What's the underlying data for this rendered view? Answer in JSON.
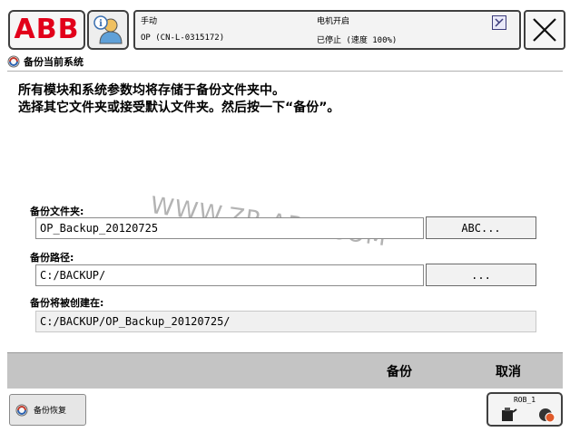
{
  "status": {
    "logo_text": "ABB",
    "mode": "手动",
    "controller": "OP (CN-L-0315172)",
    "motor": "电机开启",
    "state": "已停止 (速度 100%)"
  },
  "window": {
    "title": "备份当前系统"
  },
  "instructions": {
    "line1": "所有模块和系统参数均将存储于备份文件夹中。",
    "line2": "选择其它文件夹或接受默认文件夹。然后按一下“备份”。"
  },
  "form": {
    "folder_label": "备份文件夹:",
    "folder_value": "OP_Backup_20120725",
    "folder_button": "ABC...",
    "path_label": "备份路径:",
    "path_value": "C:/BACKUP/",
    "path_button": "...",
    "created_label": "备份将被创建在:",
    "created_value": "C:/BACKUP/OP_Backup_20120725/"
  },
  "watermark": "WWW.ZR-ABB.COM",
  "actions": {
    "backup": "备份",
    "cancel": "取消"
  },
  "taskbar": {
    "item_label": "备份恢复",
    "robot_label": "ROB_1"
  },
  "colors": {
    "abb_red": "#e2001a",
    "action_bar": "#c4c4c4",
    "frame": "#404040"
  }
}
